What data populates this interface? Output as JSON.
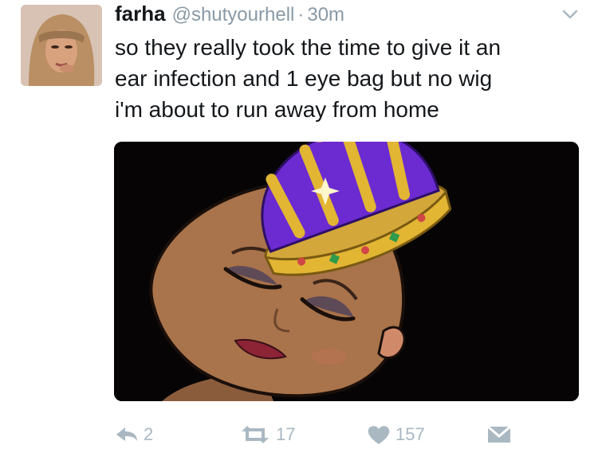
{
  "tweet": {
    "display_name": "farha",
    "handle": "@shutyourhell",
    "separator": "·",
    "time": "30m",
    "text_lines": [
      "so they really took the time to give it an",
      "ear infection and 1 eye bag but no wig",
      "i'm about to run away from home"
    ]
  },
  "actions": {
    "reply_count": "2",
    "retweet_count": "17",
    "like_count": "157"
  },
  "icons": {
    "caret": "chevron-down-icon",
    "reply": "reply-icon",
    "retweet": "retweet-icon",
    "like": "heart-icon",
    "dm": "envelope-icon"
  },
  "colors": {
    "text": "#14171a",
    "muted": "#8899a6",
    "action_gray": "#aab8c2",
    "media_bg": "#060405",
    "crown_purple": "#6b2bd1",
    "crown_gold": "#e2b533"
  }
}
